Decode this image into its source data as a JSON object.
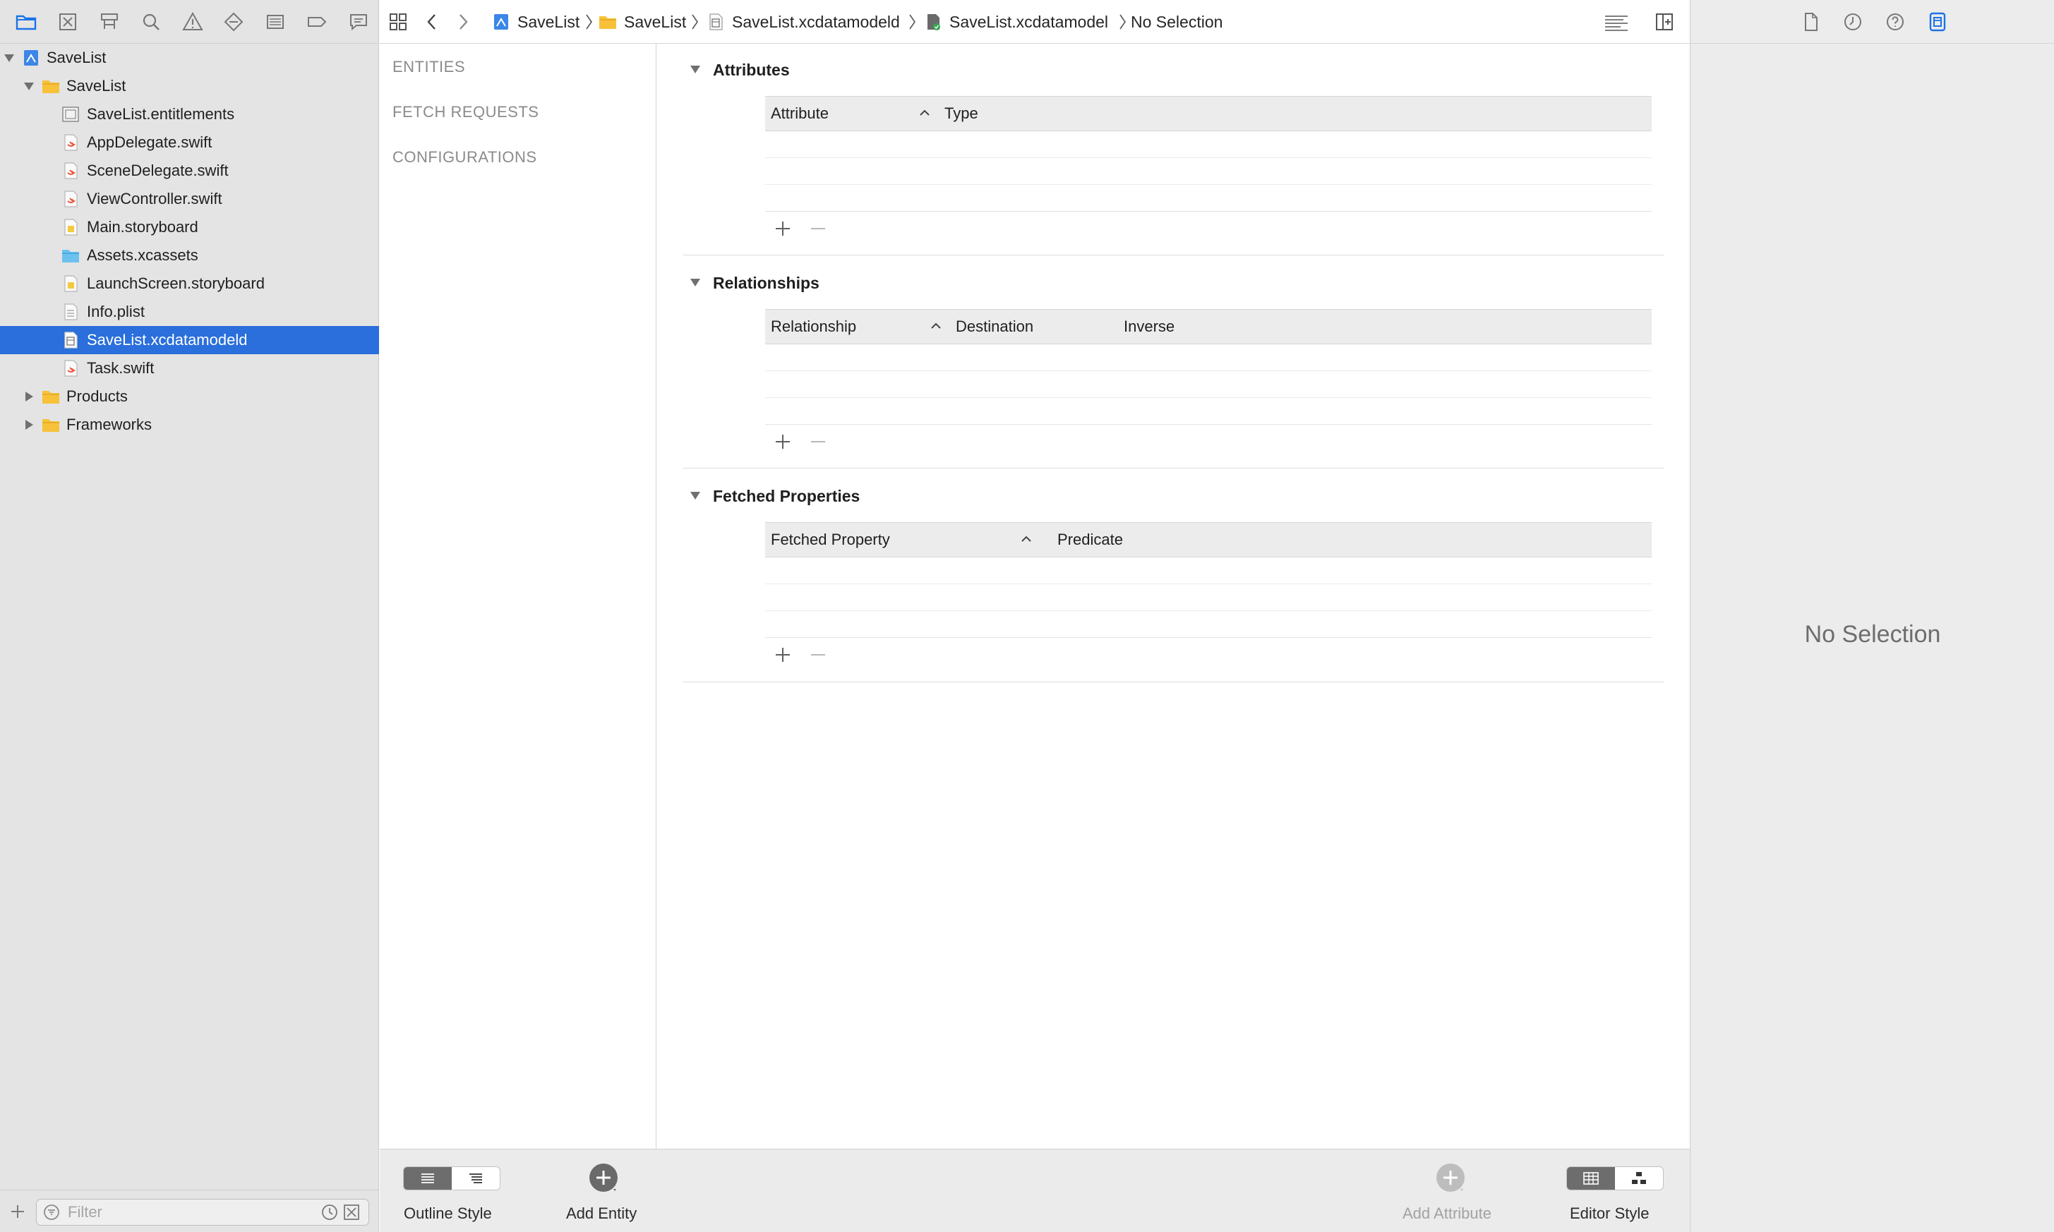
{
  "navigator": {
    "toolbar_icons": [
      "project-navigator-icon",
      "source-control-icon",
      "symbol-navigator-icon",
      "find-icon",
      "issue-icon",
      "test-icon",
      "debug-icon",
      "breakpoint-icon",
      "report-icon"
    ],
    "tree": [
      {
        "label": "SaveList",
        "icon": "project-icon",
        "expanded": true
      },
      {
        "label": "SaveList",
        "icon": "folder-icon",
        "expanded": true
      },
      {
        "label": "SaveList.entitlements",
        "icon": "entitlements-file-icon"
      },
      {
        "label": "AppDelegate.swift",
        "icon": "swift-file-icon"
      },
      {
        "label": "SceneDelegate.swift",
        "icon": "swift-file-icon"
      },
      {
        "label": "ViewController.swift",
        "icon": "swift-file-icon"
      },
      {
        "label": "Main.storyboard",
        "icon": "storyboard-file-icon"
      },
      {
        "label": "Assets.xcassets",
        "icon": "assets-folder-icon"
      },
      {
        "label": "LaunchScreen.storyboard",
        "icon": "storyboard-file-icon"
      },
      {
        "label": "Info.plist",
        "icon": "plist-file-icon"
      },
      {
        "label": "SaveList.xcdatamodeld",
        "icon": "datamodel-file-icon",
        "selected": true
      },
      {
        "label": "Task.swift",
        "icon": "swift-file-icon"
      },
      {
        "label": "Products",
        "icon": "folder-icon",
        "expanded": false
      },
      {
        "label": "Frameworks",
        "icon": "folder-icon",
        "expanded": false
      }
    ],
    "filter_placeholder": "Filter"
  },
  "jumpbar": {
    "crumbs": [
      "SaveList",
      "SaveList",
      "SaveList.xcdatamodeld",
      "SaveList.xcdatamodel",
      "No Selection"
    ]
  },
  "outline": {
    "entities_label": "ENTITIES",
    "fetch_requests_label": "FETCH REQUESTS",
    "configurations_label": "CONFIGURATIONS"
  },
  "sections": {
    "attributes": {
      "title": "Attributes",
      "columns": [
        "Attribute",
        "Type"
      ]
    },
    "relationships": {
      "title": "Relationships",
      "columns": [
        "Relationship",
        "Destination",
        "Inverse"
      ]
    },
    "fetched_properties": {
      "title": "Fetched Properties",
      "columns": [
        "Fetched Property",
        "Predicate"
      ]
    }
  },
  "editor_bottom": {
    "outline_style_label": "Outline Style",
    "add_entity_label": "Add Entity",
    "add_attribute_label": "Add Attribute",
    "editor_style_label": "Editor Style"
  },
  "inspector": {
    "no_selection": "No Selection"
  },
  "colors": {
    "selection": "#2a6fdb",
    "accent_icon": "#1a73e8"
  }
}
